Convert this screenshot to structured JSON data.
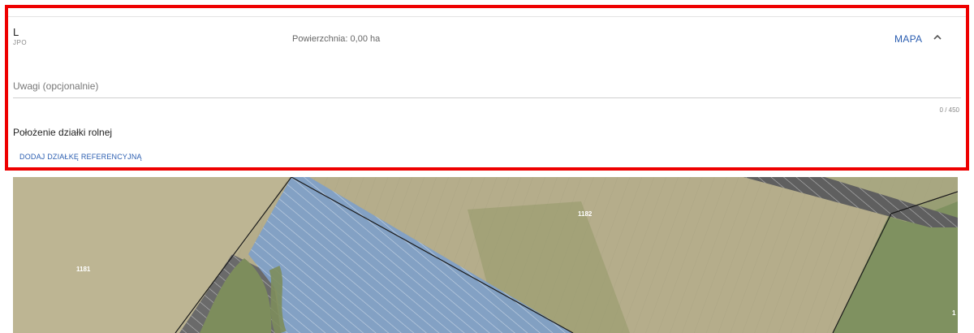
{
  "parcel": {
    "code": "L",
    "code_sub": "JPO",
    "area_text": "Powierzchnia: 0,00 ha",
    "map_label": "MAPA",
    "chevron_icon": "chevron-up-icon"
  },
  "notes": {
    "placeholder": "Uwagi (opcjonalnie)",
    "value": "",
    "counter": "0 / 450"
  },
  "location": {
    "title": "Położenie działki rolnej",
    "add_reference_label": "DODAJ DZIAŁKĘ REFERENCYJNĄ"
  },
  "map": {
    "labels": [
      "1181",
      "1182",
      "1"
    ],
    "colors": {
      "highlight": "#7fa0c9",
      "field": "#b3ad8a",
      "green": "#7f9160",
      "hatch": "#5f5f5f"
    }
  },
  "colors": {
    "accent": "#2a5db0",
    "highlight_border": "#ee0000"
  }
}
